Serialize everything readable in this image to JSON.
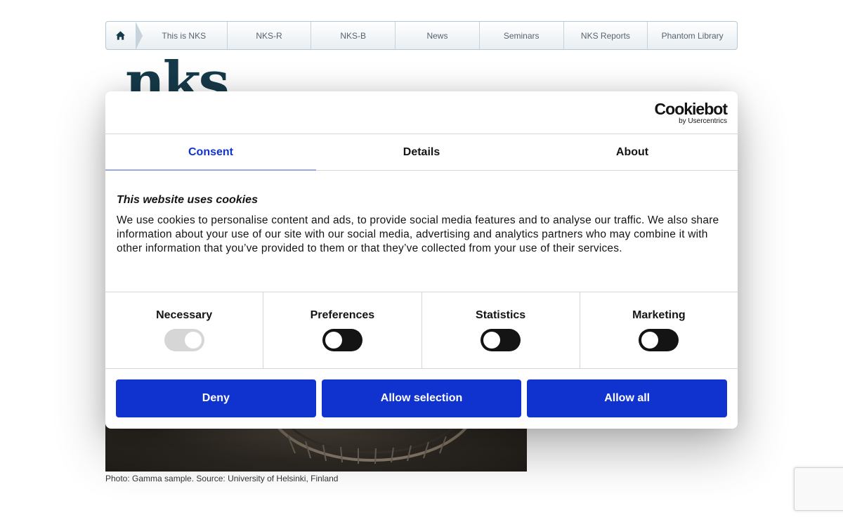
{
  "nav": {
    "home_icon": "home-icon",
    "items": [
      "This is NKS",
      "NKS-R",
      "NKS-B",
      "News",
      "Seminars",
      "NKS Reports",
      "Phantom Library"
    ]
  },
  "logo": {
    "text": "nks"
  },
  "page": {
    "caption": "Photo: Gamma sample. Source: University of Helsinki, Finland"
  },
  "cookie_dialog": {
    "brand": {
      "name": "Cookiebot",
      "byline": "by Usercentrics"
    },
    "tabs": [
      {
        "label": "Consent",
        "active": true
      },
      {
        "label": "Details",
        "active": false
      },
      {
        "label": "About",
        "active": false
      }
    ],
    "heading": "This website uses cookies",
    "body": "We use cookies to personalise content and ads, to provide social media features and to analyse our traffic. We also share information about your use of our site with our social media, advertising and analytics partners who may combine it with other information that you’ve provided to them or that they’ve collected from your use of their services.",
    "categories": [
      {
        "label": "Necessary",
        "checked": true,
        "disabled": true
      },
      {
        "label": "Preferences",
        "checked": false,
        "disabled": false
      },
      {
        "label": "Statistics",
        "checked": false,
        "disabled": false
      },
      {
        "label": "Marketing",
        "checked": false,
        "disabled": false
      }
    ],
    "buttons": {
      "deny": "Deny",
      "allow_selection": "Allow selection",
      "allow_all": "Allow all"
    }
  },
  "colors": {
    "accent": "#1032cf",
    "text": "#141414",
    "border": "#d6d6d6",
    "nav_text": "#566470",
    "logo": "#163a4a"
  }
}
